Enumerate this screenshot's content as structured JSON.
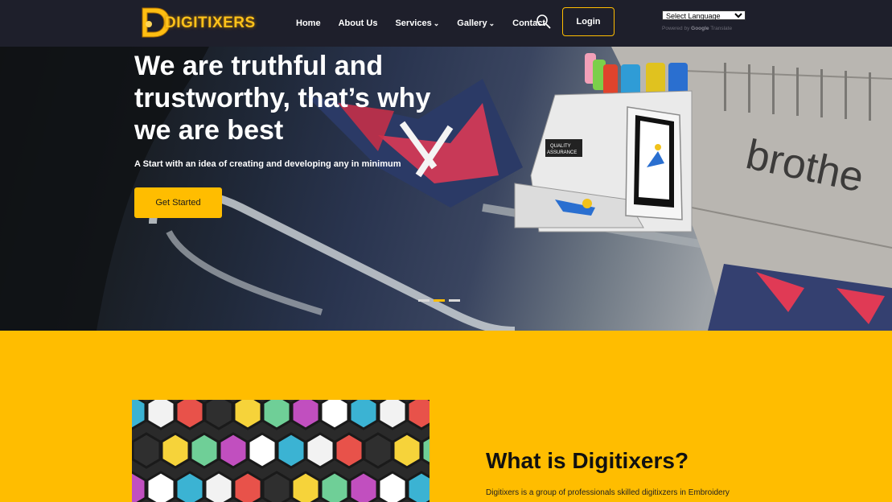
{
  "brand": {
    "name": "DIGITIXERS"
  },
  "nav": {
    "items": [
      {
        "label": "Home",
        "caret": false
      },
      {
        "label": "About Us",
        "caret": false
      },
      {
        "label": "Services",
        "caret": true
      },
      {
        "label": "Gallery",
        "caret": true
      },
      {
        "label": "Contact",
        "caret": false
      }
    ],
    "login_label": "Login",
    "language": {
      "selected": "Select Language",
      "powered_by": "Powered by",
      "google": "Google",
      "translate": "Translate"
    }
  },
  "hero": {
    "title_lines": [
      "We are truthful and",
      "trustworthy, that’s why",
      "we are best"
    ],
    "subtitle": "A Start with an idea of creating and developing any in minimum",
    "cta_label": "Get Started",
    "machine_label_1": "QUALITY",
    "machine_label_2": "ASSURANCE",
    "brand_on_machine": "brothe",
    "slides": 3,
    "active_slide": 1
  },
  "about": {
    "title": "What is Digitixers?",
    "text": "Digitixers is a group of professionals skilled digitixzers in Embroidery"
  },
  "colors": {
    "accent": "#ffbd00",
    "nav_bg": "#1e1f2b"
  }
}
